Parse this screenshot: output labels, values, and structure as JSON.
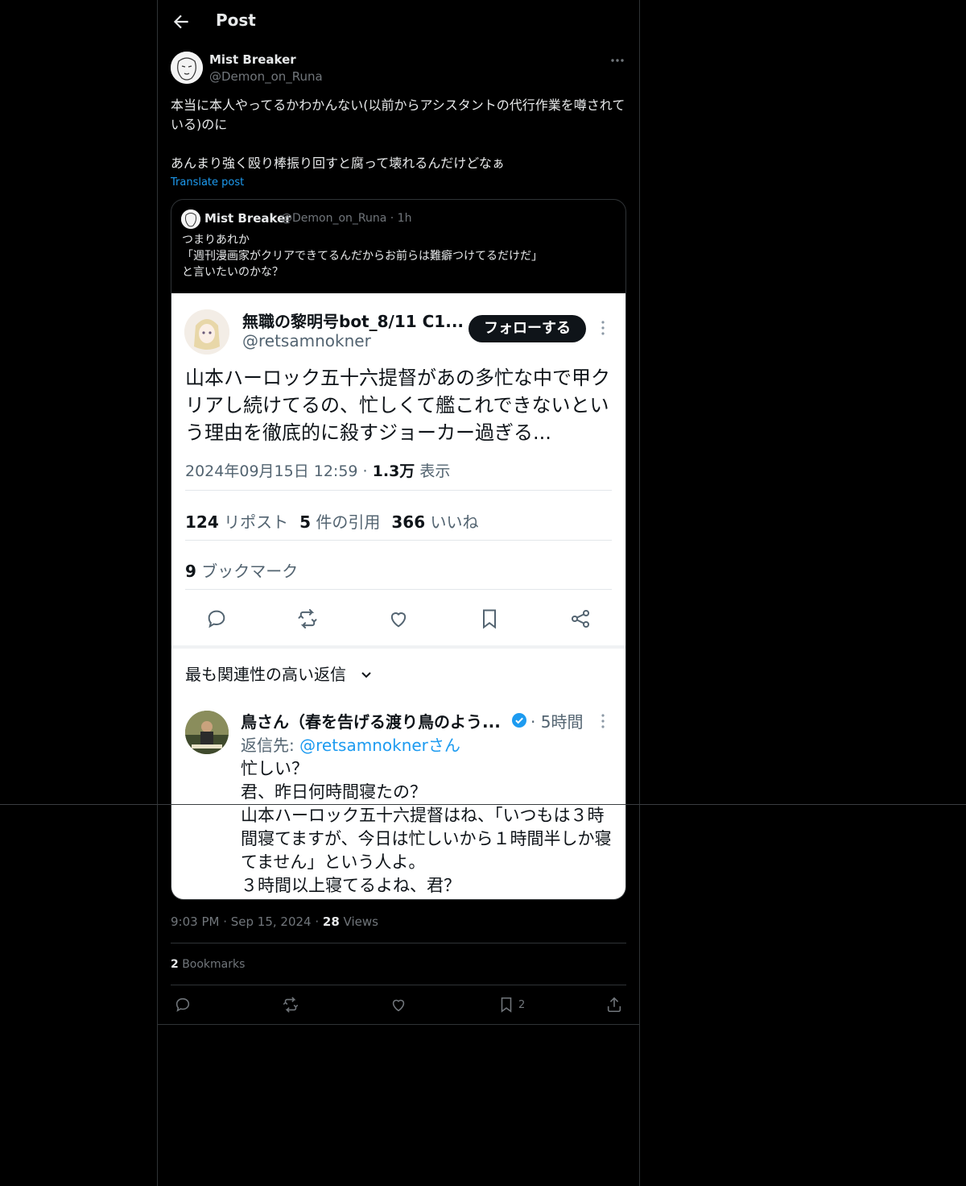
{
  "header": {
    "title": "Post"
  },
  "author": {
    "name": "Mist Breaker",
    "handle": "@Demon_on_Runa"
  },
  "post": {
    "text": "本当に本人やってるかわかんない(以前からアシスタントの代行作業を噂されている)のに\n\nあんまり強く殴り棒振り回すと腐って壊れるんだけどなぁ",
    "translate_label": "Translate post"
  },
  "quote": {
    "name": "Mist Breaker",
    "meta": "@Demon_on_Runa · 1h",
    "text": "つまりあれか\n「週刊漫画家がクリアできてるんだからお前らは難癖つけてるだけだ」\nと言いたいのかな？",
    "image": {
      "name": "無職の黎明号bot_8/11 C1...",
      "handle": "@retsamnokner",
      "follow_label": "フォローする",
      "body": "山本ハーロック五十六提督があの多忙な中で甲クリアし続けてるの、忙しくて艦これできないという理由を徹底的に殺すジョーカー過ぎる...",
      "date": "2024年09月15日 12:59 · ",
      "views_count": "1.3万",
      "views_label": " 表示",
      "reposts_count": "124",
      "reposts_label": " リポスト",
      "quotes_count": "5",
      "quotes_label": " 件の引用",
      "likes_count": "366",
      "likes_label": " いいね",
      "bookmarks_count": "9",
      "bookmarks_label": " ブックマーク",
      "sort_label": "最も関連性の高い返信",
      "reply": {
        "name": "鳥さん（春を告げる渡り鳥のよう...",
        "time": "· 5時間",
        "reply_prefix": "返信先: ",
        "reply_mention": "@retsamnoknerさん",
        "text": "忙しい？\n君、昨日何時間寝たの？\n山本ハーロック五十六提督はね、「いつもは３時間寝てますが、今日は忙しいから１時間半しか寝てません」という人よ。\n３時間以上寝てるよね、君？"
      }
    }
  },
  "footer": {
    "time": "9:03 PM · Sep 15, 2024 · ",
    "views_count": "28",
    "views_label": " Views",
    "bookmarks_count": "2",
    "bookmarks_label": " Bookmarks",
    "bookmark_action_count": "2"
  },
  "colors": {
    "background": "#000000",
    "accent": "#1d9bf0",
    "muted": "#71767b",
    "border": "#2f3336"
  }
}
